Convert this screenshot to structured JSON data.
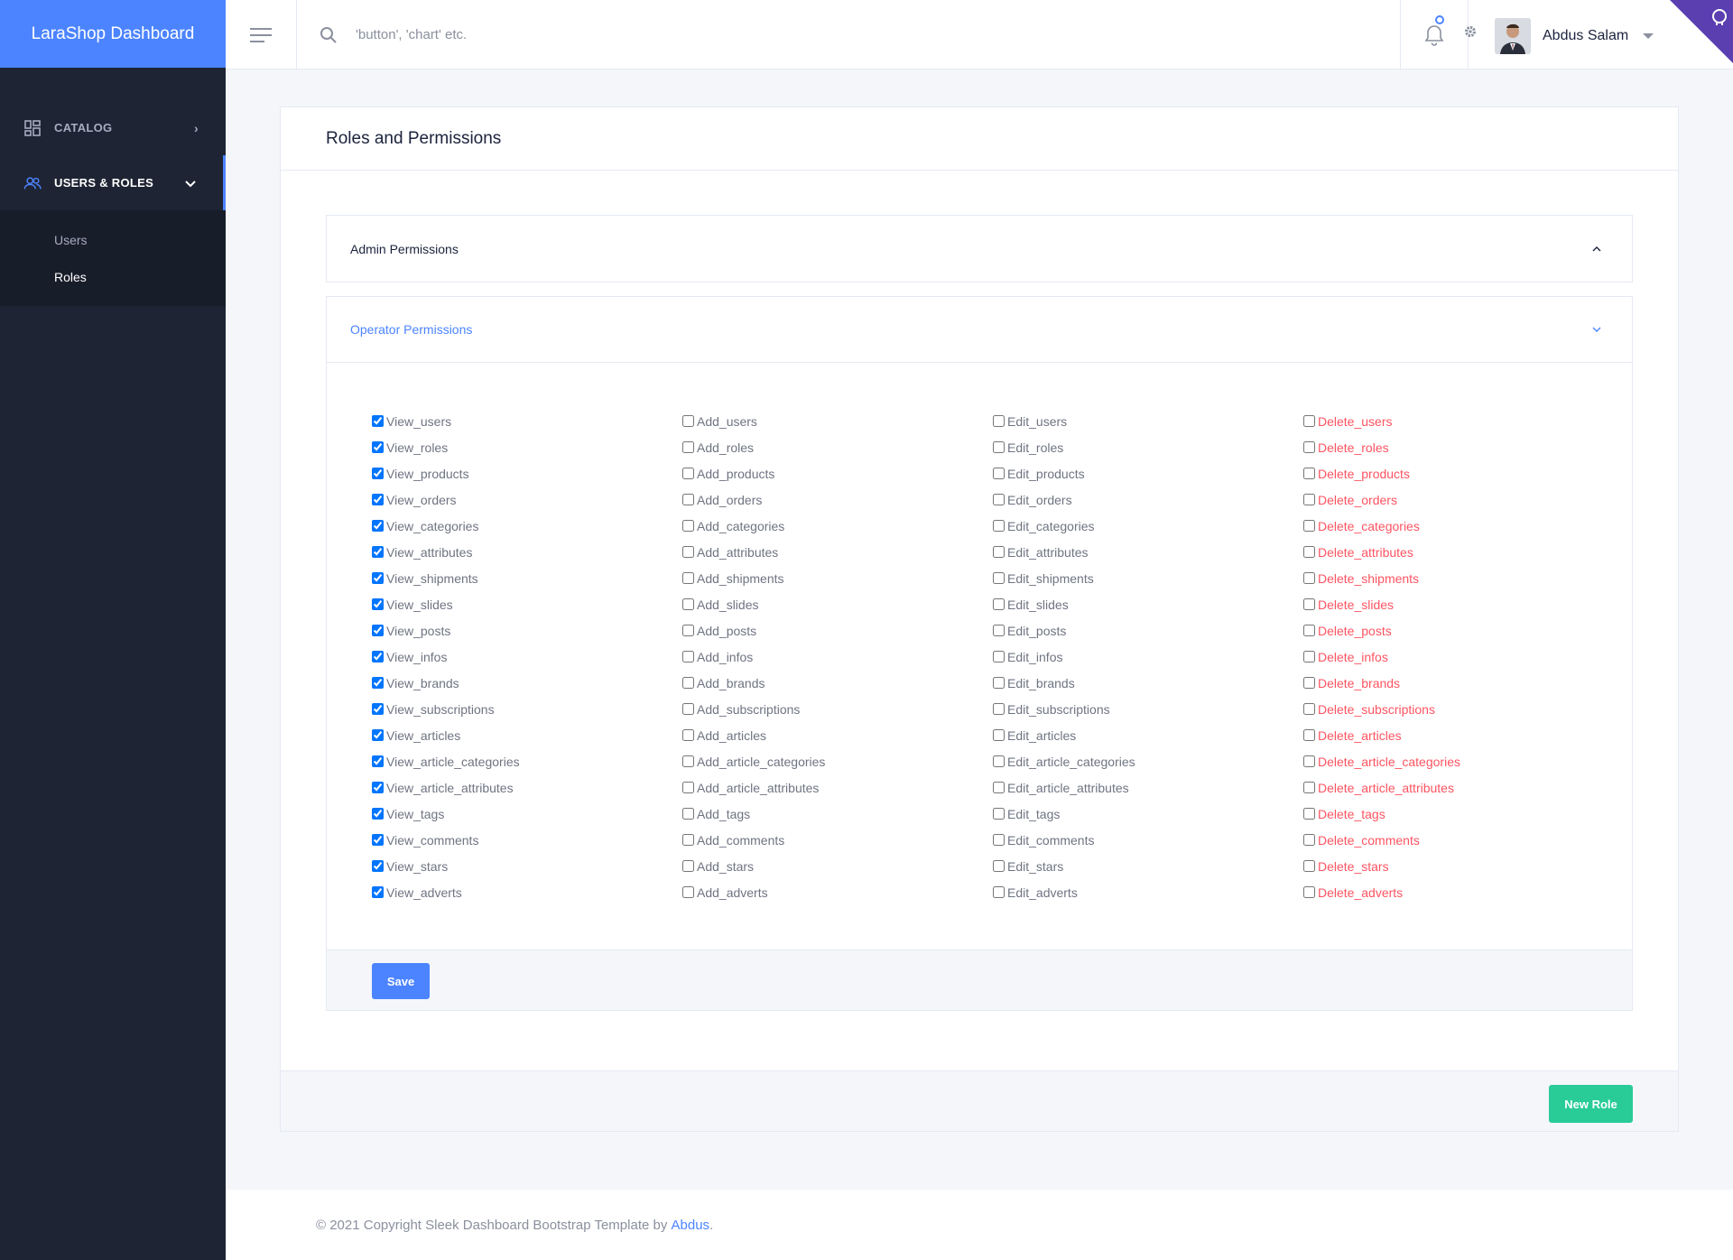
{
  "brand": "LaraShop Dashboard",
  "sidebar": {
    "items": [
      {
        "label": "CATALOG",
        "icon": "dashboard-grid-icon"
      },
      {
        "label": "USERS & ROLES",
        "icon": "users-icon"
      }
    ],
    "subitems": [
      "Users",
      "Roles"
    ]
  },
  "header": {
    "search_placeholder": "'button', 'chart' etc.",
    "user_name": "Abdus Salam"
  },
  "card": {
    "title": "Roles and Permissions",
    "accordions": [
      {
        "label": "Admin Permissions",
        "chevron": "^"
      },
      {
        "label": "Operator Permissions",
        "chevron": "v"
      }
    ],
    "save_label": "Save",
    "new_role_label": "New Role"
  },
  "permissions": {
    "view": [
      "View_users",
      "View_roles",
      "View_products",
      "View_orders",
      "View_categories",
      "View_attributes",
      "View_shipments",
      "View_slides",
      "View_posts",
      "View_infos",
      "View_brands",
      "View_subscriptions",
      "View_articles",
      "View_article_categories",
      "View_article_attributes",
      "View_tags",
      "View_comments",
      "View_stars",
      "View_adverts"
    ],
    "add": [
      "Add_users",
      "Add_roles",
      "Add_products",
      "Add_orders",
      "Add_categories",
      "Add_attributes",
      "Add_shipments",
      "Add_slides",
      "Add_posts",
      "Add_infos",
      "Add_brands",
      "Add_subscriptions",
      "Add_articles",
      "Add_article_categories",
      "Add_article_attributes",
      "Add_tags",
      "Add_comments",
      "Add_stars",
      "Add_adverts"
    ],
    "edit": [
      "Edit_users",
      "Edit_roles",
      "Edit_products",
      "Edit_orders",
      "Edit_categories",
      "Edit_attributes",
      "Edit_shipments",
      "Edit_slides",
      "Edit_posts",
      "Edit_infos",
      "Edit_brands",
      "Edit_subscriptions",
      "Edit_articles",
      "Edit_article_categories",
      "Edit_article_attributes",
      "Edit_tags",
      "Edit_comments",
      "Edit_stars",
      "Edit_adverts"
    ],
    "delete": [
      "Delete_users",
      "Delete_roles",
      "Delete_products",
      "Delete_orders",
      "Delete_categories",
      "Delete_attributes",
      "Delete_shipments",
      "Delete_slides",
      "Delete_posts",
      "Delete_infos",
      "Delete_brands",
      "Delete_subscriptions",
      "Delete_articles",
      "Delete_article_categories",
      "Delete_article_attributes",
      "Delete_tags",
      "Delete_comments",
      "Delete_stars",
      "Delete_adverts"
    ],
    "checked": {
      "view": true,
      "add": false,
      "edit": false,
      "delete": false
    }
  },
  "footer": {
    "text": "© 2021 Copyright Sleek Dashboard Bootstrap Template by ",
    "link": "Abdus",
    "end": "."
  },
  "colors": {
    "primary": "#4c84ff",
    "sidebar": "#1e2433",
    "success": "#29cc97",
    "danger": "#fe5461"
  }
}
